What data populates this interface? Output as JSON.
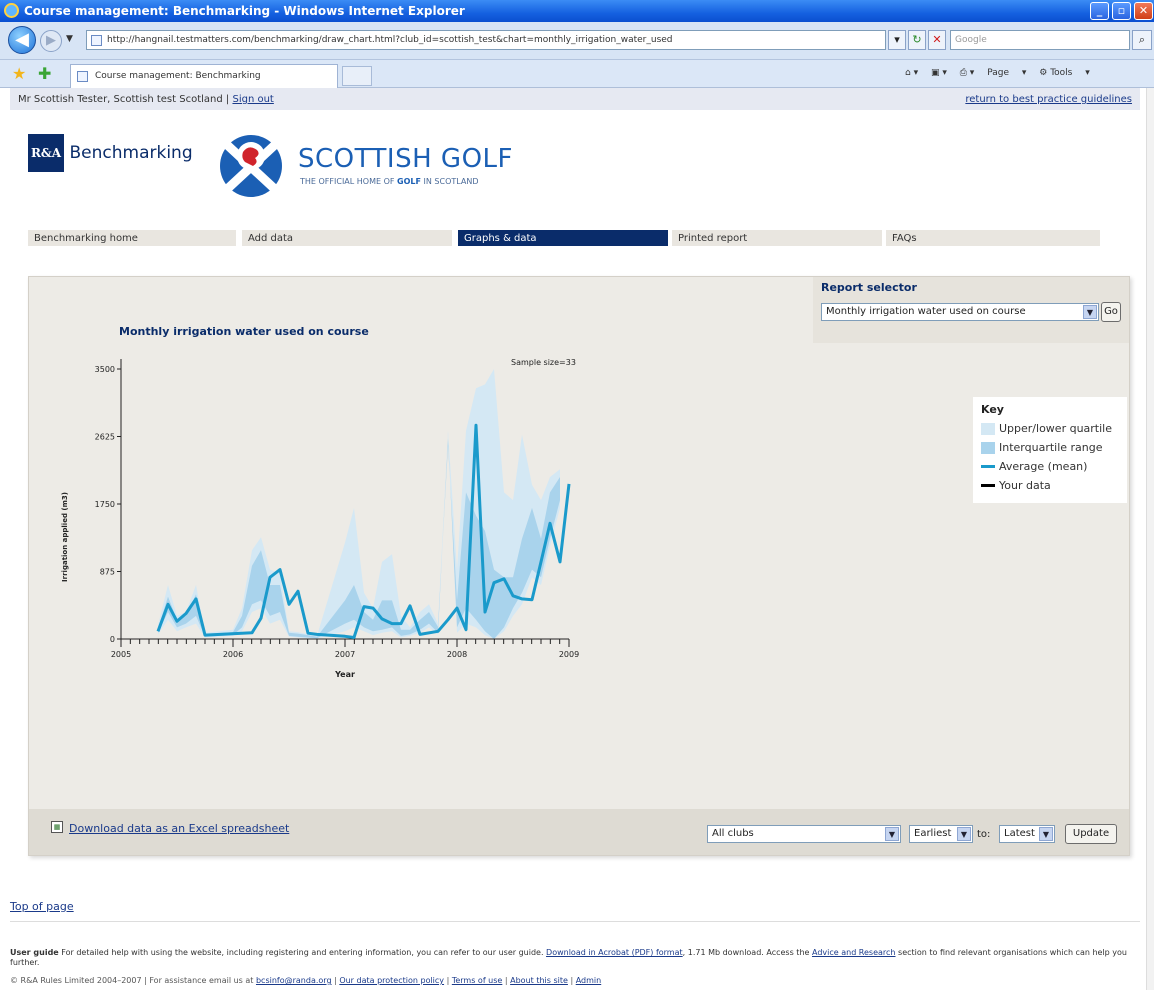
{
  "browser": {
    "title": "Course management: Benchmarking - Windows Internet Explorer",
    "url": "http://hangnail.testmatters.com/benchmarking/draw_chart.html?club_id=scottish_test&chart=monthly_irrigation_water_used",
    "search_placeholder": "Google",
    "tab_title": "Course management: Benchmarking",
    "cmd_page": "Page",
    "cmd_tools": "Tools"
  },
  "userbar": {
    "user_text": "Mr Scottish Tester, Scottish test Scotland",
    "separator": "|",
    "sign_out": "Sign out",
    "return_link": "return to best practice guidelines"
  },
  "logos": {
    "ra_box": "R&A",
    "ra_text": "Benchmarking",
    "sg_title": "SCOTTISH GOLF",
    "sg_sub_pre": "THE OFFICIAL HOME OF ",
    "sg_sub_golf": "GOLF",
    "sg_sub_post": " IN SCOTLAND"
  },
  "nav": {
    "items": [
      {
        "label": "Benchmarking home",
        "active": false
      },
      {
        "label": "Add data",
        "active": false
      },
      {
        "label": "Graphs & data",
        "active": true
      },
      {
        "label": "Printed report",
        "active": false
      },
      {
        "label": "FAQs",
        "active": false
      }
    ]
  },
  "report_selector": {
    "label": "Report selector",
    "selected": "Monthly irrigation water used on course",
    "go": "Go"
  },
  "key": {
    "title": "Key",
    "items": [
      {
        "label": "Upper/lower quartile",
        "color": "#d4e8f4",
        "kind": "area"
      },
      {
        "label": "Interquartile range",
        "color": "#a9d3ec",
        "kind": "area"
      },
      {
        "label": "Average (mean)",
        "color": "#1a9acb",
        "kind": "line"
      },
      {
        "label": "Your data",
        "color": "#000000",
        "kind": "line"
      }
    ]
  },
  "chart_data": {
    "type": "area",
    "title": "Monthly irrigation water used on course",
    "annotation": "Sample size=33",
    "xlabel": "Year",
    "ylabel": "Irrigation applied (m3)",
    "ylim": [
      0,
      3500
    ],
    "yticks": [
      0,
      875,
      1750,
      2625,
      3500
    ],
    "xticks": [
      "2005",
      "2006",
      "2007",
      "2008",
      "2009"
    ],
    "xlim": [
      2005.0,
      2009.0
    ],
    "x": [
      2005.33,
      2005.42,
      2005.5,
      2005.58,
      2005.67,
      2005.75,
      2006.0,
      2006.08,
      2006.17,
      2006.25,
      2006.33,
      2006.42,
      2006.5,
      2006.58,
      2006.67,
      2006.75,
      2007.0,
      2007.08,
      2007.17,
      2007.25,
      2007.33,
      2007.42,
      2007.5,
      2007.58,
      2007.67,
      2007.75,
      2007.83,
      2007.92,
      2008.0,
      2008.08,
      2008.17,
      2008.25,
      2008.33,
      2008.42,
      2008.5,
      2008.58,
      2008.67,
      2008.75,
      2008.83,
      2008.92
    ],
    "series": [
      {
        "name": "Upper/lower quartile",
        "role": "outer_upper",
        "values": [
          180,
          700,
          300,
          350,
          700,
          80,
          120,
          400,
          1150,
          1320,
          900,
          850,
          100,
          90,
          60,
          40,
          1250,
          1700,
          600,
          400,
          1000,
          1100,
          300,
          150,
          350,
          450,
          200,
          2700,
          900,
          2700,
          3250,
          3300,
          3500,
          1900,
          1800,
          2650,
          2000,
          1800,
          2100,
          2200
        ]
      },
      {
        "name": "Interquartile range",
        "role": "iqr_upper",
        "values": [
          140,
          550,
          250,
          300,
          580,
          60,
          90,
          300,
          950,
          1150,
          700,
          700,
          80,
          70,
          50,
          30,
          500,
          700,
          350,
          250,
          500,
          500,
          120,
          120,
          250,
          350,
          160,
          2500,
          500,
          1900,
          1600,
          1400,
          900,
          800,
          800,
          1300,
          1700,
          1300,
          1900,
          2100
        ]
      },
      {
        "name": "Interquartile range",
        "role": "iqr_lower",
        "values": [
          80,
          350,
          150,
          200,
          300,
          30,
          50,
          150,
          450,
          500,
          300,
          350,
          40,
          30,
          20,
          10,
          200,
          250,
          150,
          100,
          120,
          150,
          40,
          60,
          120,
          200,
          80,
          2600,
          150,
          400,
          250,
          100,
          0,
          150,
          400,
          600,
          900,
          800,
          1300,
          1800
        ]
      },
      {
        "name": "Upper/lower quartile",
        "role": "outer_lower",
        "values": [
          60,
          250,
          100,
          150,
          200,
          20,
          40,
          100,
          350,
          400,
          200,
          250,
          30,
          20,
          10,
          5,
          100,
          150,
          100,
          50,
          80,
          100,
          20,
          40,
          80,
          150,
          60,
          2650,
          80,
          200,
          150,
          50,
          0,
          100,
          300,
          450,
          800,
          700,
          1200,
          1700
        ]
      },
      {
        "name": "Average (mean)",
        "role": "mean",
        "values": [
          100,
          450,
          230,
          330,
          520,
          50,
          80,
          270,
          800,
          900,
          450,
          620,
          75,
          60,
          35,
          20,
          420,
          400,
          260,
          200,
          200,
          430,
          60,
          100,
          250,
          400,
          120,
          2770,
          350,
          730,
          780,
          560,
          520,
          510,
          1000,
          1500,
          1000,
          2010
        ]
      }
    ],
    "mean_x": [
      2005.33,
      2005.42,
      2005.5,
      2005.58,
      2005.67,
      2005.75,
      2006.17,
      2006.25,
      2006.33,
      2006.42,
      2006.5,
      2006.58,
      2006.67,
      2006.75,
      2007.0,
      2007.08,
      2007.17,
      2007.25,
      2007.33,
      2007.42,
      2007.5,
      2007.58,
      2007.67,
      2007.83,
      2007.92,
      2008.0,
      2008.08,
      2008.17,
      2008.25,
      2008.33,
      2008.42,
      2008.5,
      2008.58,
      2008.67,
      2008.75,
      2008.83,
      2008.92,
      2009.0
    ]
  },
  "filters": {
    "download_link": "Download data as an Excel spreadsheet",
    "club_scope": "All clubs",
    "from": "Earliest",
    "to_label": "to:",
    "to": "Latest",
    "update": "Update"
  },
  "footer": {
    "top_link": "Top of page",
    "guide_bold": "User guide",
    "guide_text": " For detailed help with using the website, including registering and entering information, you can refer to our user guide. ",
    "guide_link": "Download in Acrobat (PDF) format",
    "guide_size": ", 1.71 Mb download. Access the ",
    "advice_link": "Advice and Research",
    "guide_text2": " section to find relevant organisations which can help you further.",
    "copyright": "© R&A Rules Limited 2004–2007 | For assistance email us at ",
    "email": "bcsinfo@randa.org",
    "links": [
      "Our data protection policy",
      "Terms of use",
      "About this site",
      "Admin"
    ]
  }
}
